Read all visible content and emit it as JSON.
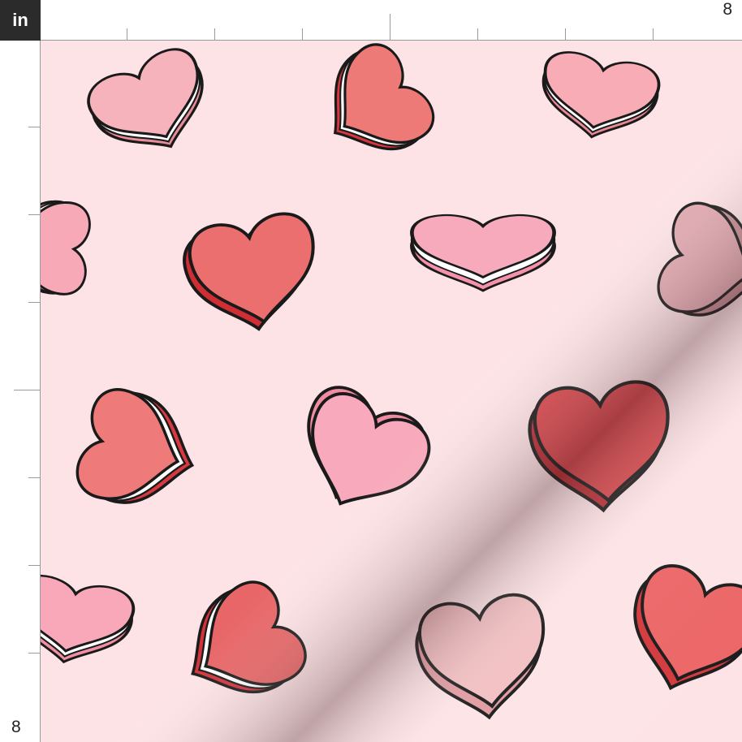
{
  "ruler": {
    "unit": "in",
    "top_label": "8",
    "left_label": "8"
  },
  "swatch": {
    "description_colors": {
      "background": "#fde3e6",
      "light_pink": "#f7a9b8",
      "salmon": "#ef7b79",
      "red": "#dc3b40",
      "dusty_rose": "#ecbcbd",
      "filling": "#ffffff",
      "outline": "#1a1a1a"
    }
  }
}
